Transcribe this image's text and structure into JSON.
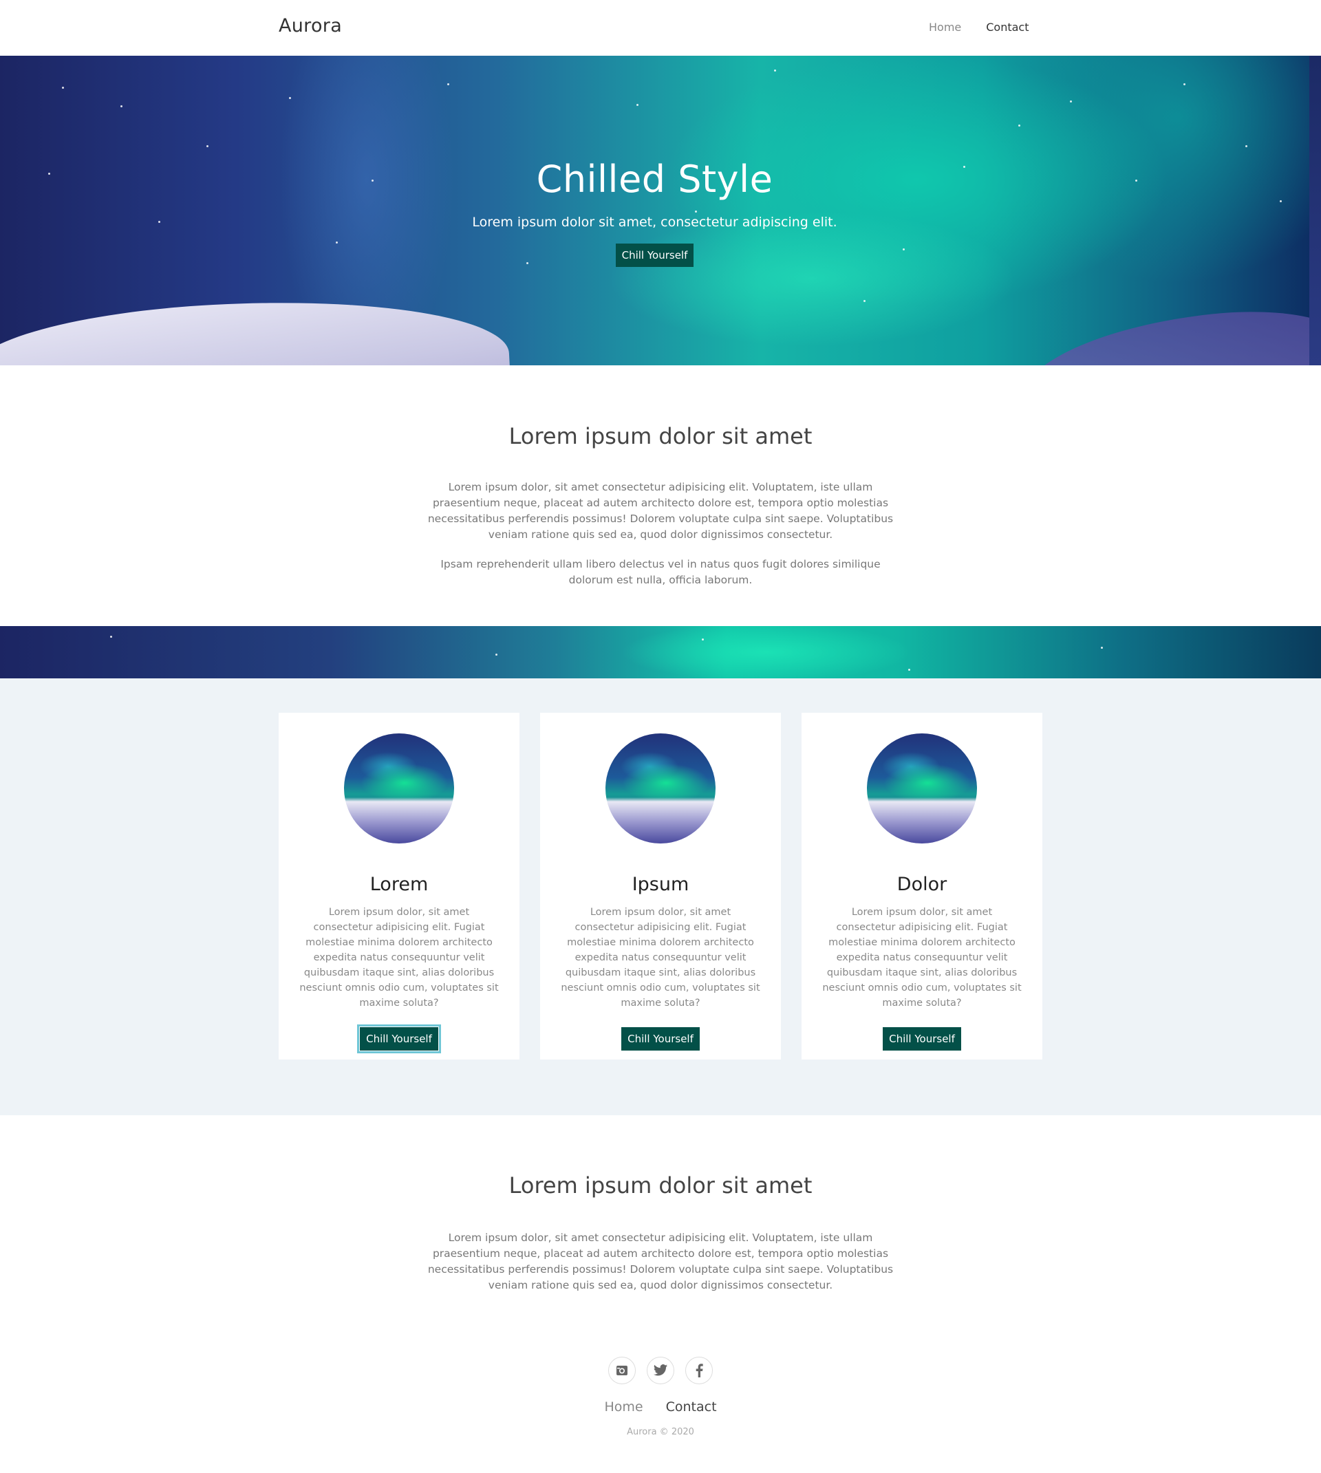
{
  "nav": {
    "brand": "Aurora",
    "links": [
      "Home",
      "Contact"
    ]
  },
  "hero": {
    "title": "Chilled Style",
    "subtitle": "Lorem ipsum dolor sit amet, consectetur adipiscing elit.",
    "button": "Chill Yourself"
  },
  "intro": {
    "title": "Lorem ipsum dolor sit amet",
    "paragraph1": "Lorem ipsum dolor, sit amet consectetur adipisicing elit. Voluptatem, iste ullam praesentium neque, placeat ad autem architecto dolore est, tempora optio molestias necessitatibus perferendis possimus! Dolorem voluptate culpa sint saepe. Voluptatibus veniam ratione quis sed ea, quod dolor dignissimos consectetur.",
    "paragraph2": "Ipsam reprehenderit ullam libero delectus vel in natus quos fugit dolores similique dolorum est nulla, officia laborum."
  },
  "cards": [
    {
      "title": "Lorem",
      "text": "Lorem ipsum dolor, sit amet consectetur adipisicing elit. Fugiat molestiae minima dolorem architecto expedita natus consequuntur velit quibusdam itaque sint, alias doloribus nesciunt omnis odio cum, voluptates sit maxime soluta?",
      "button": "Chill Yourself"
    },
    {
      "title": "Ipsum",
      "text": "Lorem ipsum dolor, sit amet consectetur adipisicing elit. Fugiat molestiae minima dolorem architecto expedita natus consequuntur velit quibusdam itaque sint, alias doloribus nesciunt omnis odio cum, voluptates sit maxime soluta?",
      "button": "Chill Yourself"
    },
    {
      "title": "Dolor",
      "text": "Lorem ipsum dolor, sit amet consectetur adipisicing elit. Fugiat molestiae minima dolorem architecto expedita natus consequuntur velit quibusdam itaque sint, alias doloribus nesciunt omnis odio cum, voluptates sit maxime soluta?",
      "button": "Chill Yourself"
    }
  ],
  "second": {
    "title": "Lorem ipsum dolor sit amet",
    "paragraph": "Lorem ipsum dolor, sit amet consectetur adipisicing elit. Voluptatem, iste ullam praesentium neque, placeat ad autem architecto dolore est, tempora optio molestias necessitatibus perferendis possimus! Dolorem voluptate culpa sint saepe. Voluptatibus veniam ratione quis sed ea, quod dolor dignissimos consectetur."
  },
  "footer": {
    "social_icons": [
      "instagram-icon",
      "twitter-icon",
      "facebook-icon"
    ],
    "links": [
      "Home",
      "Contact"
    ],
    "copyright": "Aurora © 2020"
  },
  "colors": {
    "button": "#035048",
    "cards_background": "#eef3f7",
    "focus_ring": "#6fc6d6"
  }
}
